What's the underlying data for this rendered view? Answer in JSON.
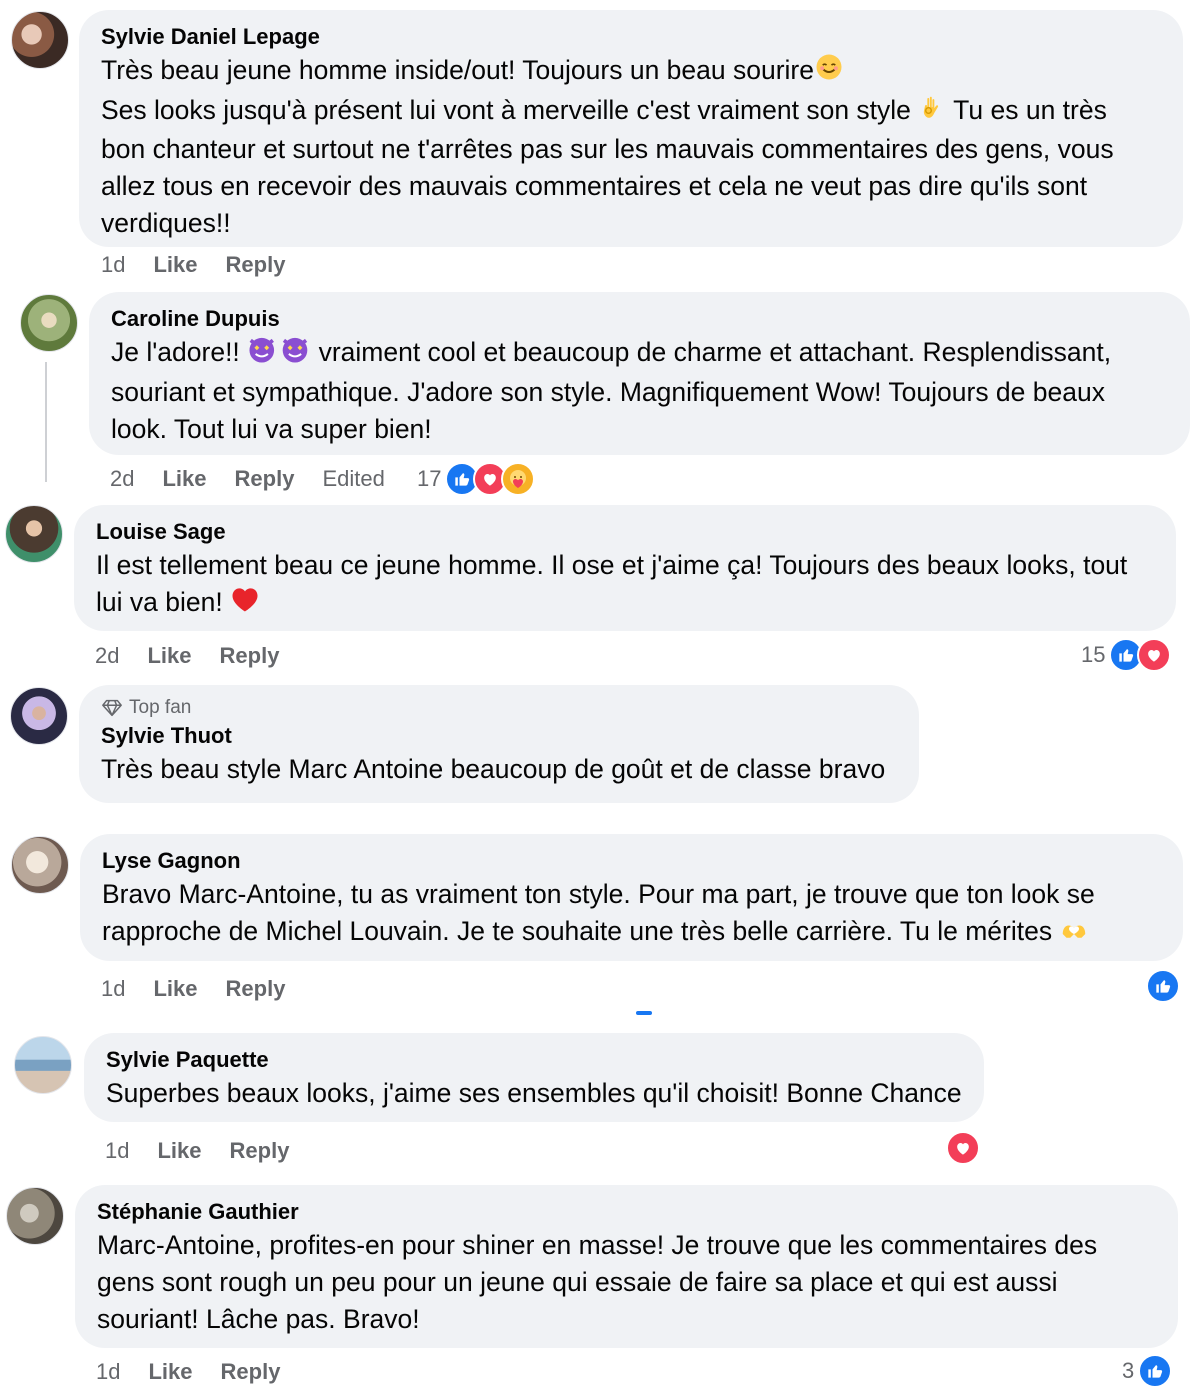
{
  "comments": [
    {
      "author": "Sylvie Daniel Lepage",
      "lines": [
        "Très beau jeune homme inside/out! Toujours un beau sourire",
        "Ses looks jusqu'à présent lui vont à merveille c'est vraiment son style",
        "Tu es un très",
        "bon chanteur et surtout ne t'arrêtes pas sur les mauvais commentaires des gens, vous",
        "allez tous en recevoir des mauvais commentaires et cela ne veut pas dire qu'ils sont",
        "verdiques!!"
      ],
      "time": "1d",
      "like": "Like",
      "reply": "Reply"
    },
    {
      "author": "Caroline Dupuis",
      "lines": [
        "Je l'adore!!",
        "vraiment cool et beaucoup de charme et attachant. Resplendissant,",
        "souriant et sympathique. J'adore son style. Magnifiquement Wow! Toujours de beaux",
        "look. Tout lui va super bien!"
      ],
      "time": "2d",
      "like": "Like",
      "reply": "Reply",
      "edited": "Edited",
      "reaction_count": "17",
      "reactions": [
        "like-icon",
        "love-icon",
        "care-icon"
      ]
    },
    {
      "author": "Louise Sage",
      "lines": [
        "Il est tellement beau ce jeune homme. Il ose et j'aime ça! Toujours des beaux looks, tout",
        "lui va bien!"
      ],
      "time": "2d",
      "like": "Like",
      "reply": "Reply",
      "reaction_count": "15",
      "reactions": [
        "like-icon",
        "love-icon"
      ]
    },
    {
      "badge": "Top fan",
      "author": "Sylvie Thuot",
      "lines": [
        "Très beau style Marc Antoine beaucoup de goût et de classe bravo"
      ]
    },
    {
      "author": "Lyse Gagnon",
      "lines": [
        "Bravo Marc-Antoine, tu as vraiment ton style. Pour ma part, je trouve que ton look se",
        "rapproche de Michel Louvain. Je te souhaite une très belle carrière. Tu le mérites"
      ],
      "time": "1d",
      "like": "Like",
      "reply": "Reply",
      "reactions": [
        "like-icon"
      ]
    },
    {
      "author": "Sylvie Paquette",
      "lines": [
        "Superbes beaux looks, j'aime ses ensembles qu'il choisit! Bonne Chance"
      ],
      "time": "1d",
      "like": "Like",
      "reply": "Reply",
      "reactions": [
        "love-icon"
      ]
    },
    {
      "author": "Stéphanie Gauthier",
      "lines": [
        "Marc-Antoine, profites-en pour shiner en masse! Je trouve que les commentaires des",
        "gens sont rough un peu pour un jeune qui essaie de faire sa place et qui est aussi",
        "souriant! Lâche pas. Bravo!"
      ],
      "time": "1d",
      "like": "Like",
      "reply": "Reply",
      "reaction_count": "3",
      "reactions": [
        "like-icon"
      ]
    }
  ],
  "colors": {
    "bubble": "#f0f2f5",
    "meta_text": "#65676b",
    "like_blue": "#1877f2",
    "love_red": "#f33e58",
    "care_yellow": "#f7b125"
  }
}
